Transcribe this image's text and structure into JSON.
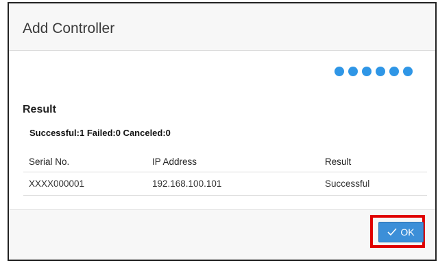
{
  "dialog": {
    "title": "Add Controller"
  },
  "progress": {
    "dot_count": 6,
    "color": "#2f96e6"
  },
  "result": {
    "heading": "Result",
    "summary": "Successful:1 Failed:0 Canceled:0",
    "table": {
      "columns": [
        "Serial No.",
        "IP Address",
        "Result"
      ],
      "rows": [
        [
          "XXXX000001",
          "192.168.100.101",
          "Successful"
        ]
      ]
    }
  },
  "footer": {
    "ok_label": "OK",
    "ok_icon": "check-icon",
    "button_color": "#3c8fd8",
    "highlight_color": "#e00000"
  }
}
